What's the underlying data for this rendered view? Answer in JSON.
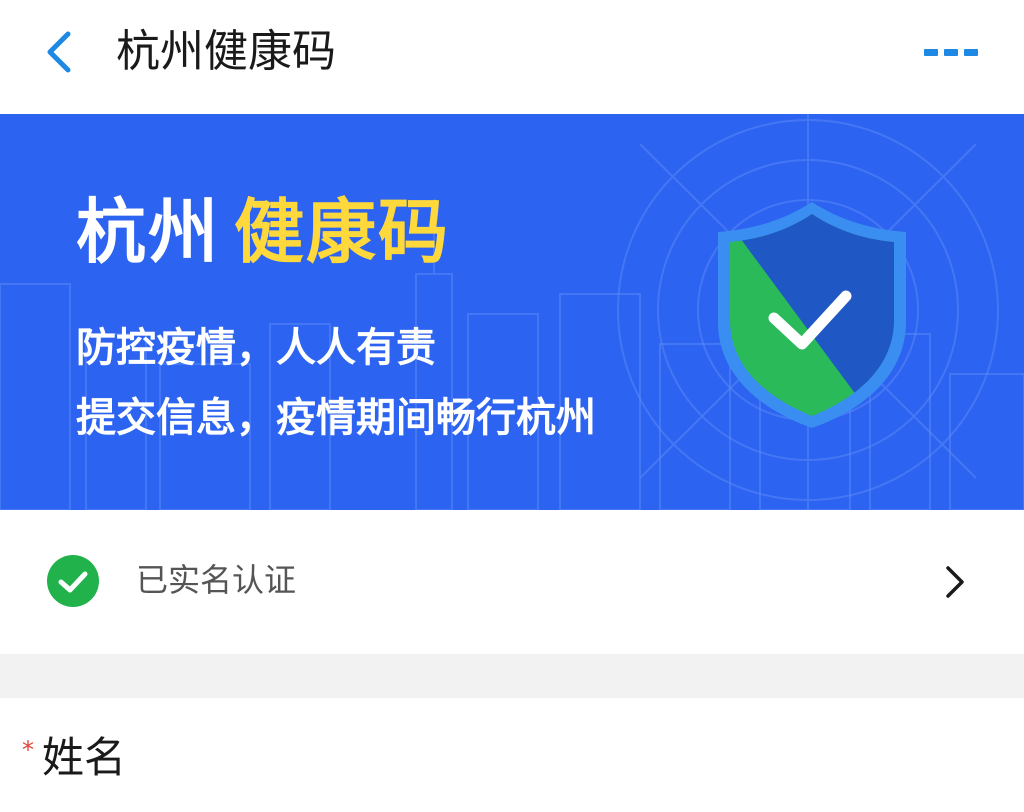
{
  "header": {
    "title": "杭州健康码",
    "back_icon": "chevron-left-icon",
    "more_icon": "more-dots-icon"
  },
  "banner": {
    "title_city": "杭州",
    "title_code": "健康码",
    "line1": "防控疫情，人人有责",
    "line2": "提交信息，疫情期间畅行杭州",
    "background_color": "#2c63f0",
    "highlight_color": "#ffd83c",
    "emblem_icon": "shield-check-icon"
  },
  "verification": {
    "label": "已实名认证",
    "status_icon": "check-circle-icon",
    "status_color": "#22b24c",
    "arrow_icon": "chevron-right-icon"
  },
  "form": {
    "required_mark": "*",
    "name_label": "姓名"
  },
  "colors": {
    "accent": "#1e88e5"
  }
}
